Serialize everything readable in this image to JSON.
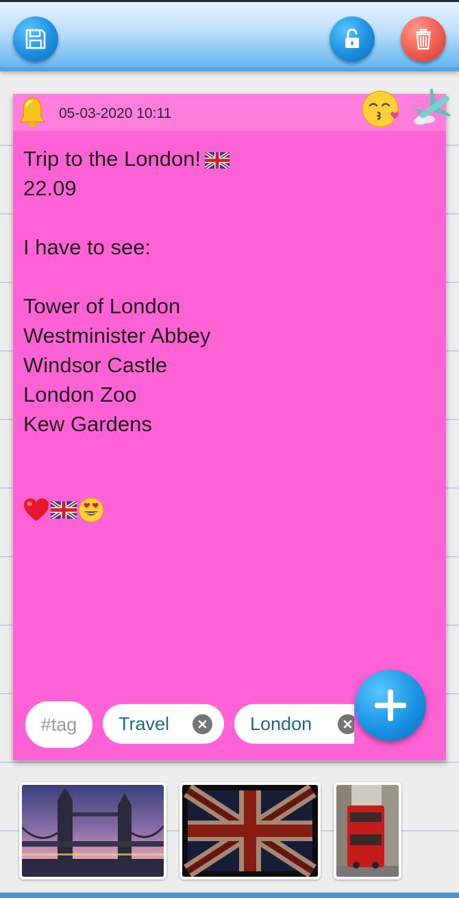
{
  "toolbar": {
    "save_icon": "save-icon",
    "lock_icon": "unlock-icon",
    "delete_icon": "trash-icon"
  },
  "note": {
    "date": "05-03-2020 10:11",
    "background_color": "#ff62d4",
    "header_color": "#ff7ddc",
    "lines": [
      "Trip to the London!",
      "22.09",
      "",
      "I have to see:",
      "",
      "Tower of London",
      "Westminister Abbey",
      "Windsor Castle",
      "London Zoo",
      "Kew Gardens"
    ],
    "emojis": [
      "red-heart",
      "uk-flag",
      "heart-eyes-face"
    ]
  },
  "tags": {
    "placeholder": "#tag",
    "items": [
      "Travel",
      "London"
    ]
  },
  "thumbnails": [
    "tower-bridge-photo",
    "union-jack-photo",
    "red-bus-photo"
  ]
}
